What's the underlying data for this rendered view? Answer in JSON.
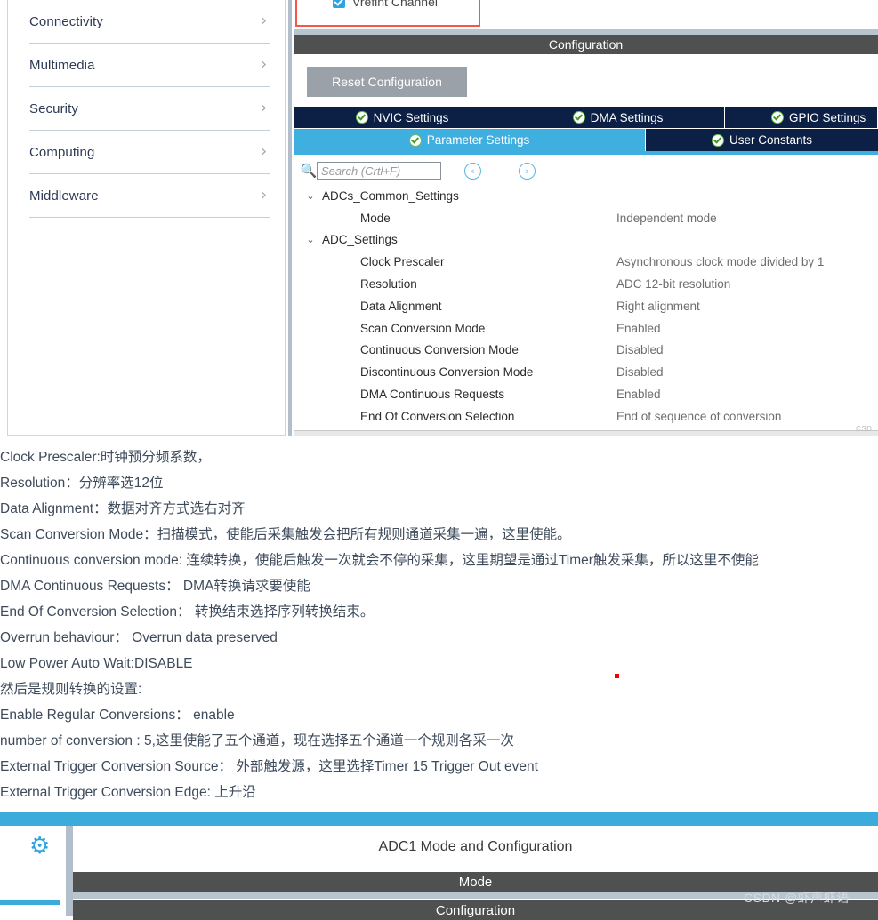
{
  "sidebar": {
    "items": [
      {
        "label": "Connectivity",
        "icon": "chevron-right-icon"
      },
      {
        "label": "Multimedia",
        "icon": "chevron-right-icon"
      },
      {
        "label": "Security",
        "icon": "chevron-right-icon"
      },
      {
        "label": "Computing",
        "icon": "chevron-right-icon"
      },
      {
        "label": "Middleware",
        "icon": "chevron-right-icon"
      }
    ]
  },
  "vrefint": {
    "label": "Vrefint Channel",
    "checked": true,
    "highlight_color": "#f4564a"
  },
  "config_panel": {
    "title": "Configuration",
    "reset_button": "Reset Configuration",
    "tabs_row1": [
      {
        "label": "NVIC Settings",
        "active": false
      },
      {
        "label": "DMA Settings",
        "active": false
      },
      {
        "label": "GPIO Settings",
        "active": false
      }
    ],
    "tabs_row2": [
      {
        "label": "Parameter Settings",
        "active": true
      },
      {
        "label": "User Constants",
        "active": false
      }
    ],
    "accent_color": "#3fafe0",
    "tab_color": "#0c2045"
  },
  "search": {
    "placeholder": "Search (Crtl+F)",
    "value": "",
    "icon": "search-icon",
    "prev_icon": "‹",
    "next_icon": "›"
  },
  "param_tree": [
    {
      "type": "group",
      "twisty": "⌄",
      "name": "ADCs_Common_Settings",
      "value": ""
    },
    {
      "type": "leaf",
      "twisty": "",
      "name": "Mode",
      "value": "Independent mode"
    },
    {
      "type": "group",
      "twisty": "⌄",
      "name": "ADC_Settings",
      "value": ""
    },
    {
      "type": "leaf",
      "twisty": "",
      "name": "Clock Prescaler",
      "value": "Asynchronous clock mode divided by 1"
    },
    {
      "type": "leaf",
      "twisty": "",
      "name": "Resolution",
      "value": "ADC 12-bit resolution"
    },
    {
      "type": "leaf",
      "twisty": "",
      "name": "Data Alignment",
      "value": "Right alignment"
    },
    {
      "type": "leaf",
      "twisty": "",
      "name": "Scan Conversion Mode",
      "value": "Enabled"
    },
    {
      "type": "leaf",
      "twisty": "",
      "name": "Continuous Conversion Mode",
      "value": "Disabled"
    },
    {
      "type": "leaf",
      "twisty": "",
      "name": "Discontinuous Conversion Mode",
      "value": "Disabled"
    },
    {
      "type": "leaf",
      "twisty": "",
      "name": "DMA Continuous Requests",
      "value": "Enabled"
    },
    {
      "type": "leaf",
      "twisty": "",
      "name": "End Of Conversion Selection",
      "value": "End of sequence of conversion"
    }
  ],
  "tree_watermark": "CSD",
  "notes": [
    "Clock Prescaler:时钟预分频系数，",
    "Resolution：分辨率选12位",
    "Data Alignment：数据对齐方式选右对齐",
    "Scan Conversion Mode：扫描模式，使能后采集触发会把所有规则通道采集一遍，这里使能。",
    "Continuous conversion mode: 连续转换，使能后触发一次就会不停的采集，这里期望是通过Timer触发采集，所以这里不使能",
    "DMA Continuous Requests： DMA转换请求要使能",
    "End Of Conversion Selection： 转换结束选择序列转换结束。",
    "Overrun behaviour： Overrun data preserved",
    "Low Power Auto Wait:DISABLE",
    "然后是规则转换的设置:",
    "Enable Regular Conversions： enable",
    "number of conversion : 5,这里使能了五个通道，现在选择五个通道一个规则各采一次",
    "External Trigger Conversion Source： 外部触发源，这里选择Timer 15 Trigger Out event",
    "External Trigger Conversion Edge: 上升沿"
  ],
  "bottom": {
    "gear_icon": "gear-icon",
    "adc_title": "ADC1 Mode and Configuration",
    "mode_bar": "Mode",
    "config_bar": "Configuration",
    "accent_color": "#3aabdb"
  },
  "watermark": "CSDN @虾声虾语"
}
